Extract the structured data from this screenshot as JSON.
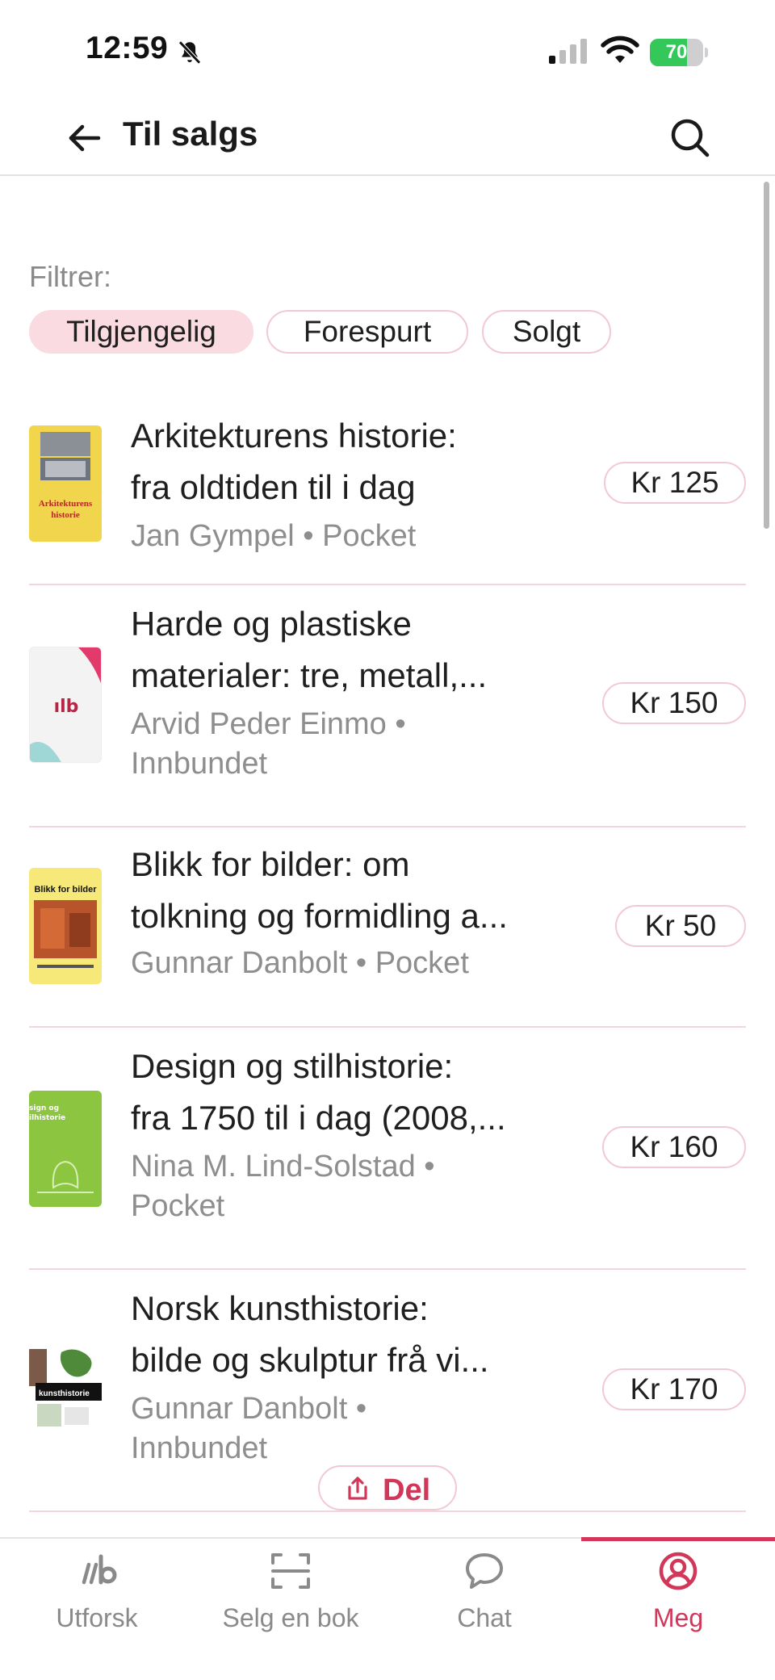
{
  "status_bar": {
    "time": "12:59",
    "battery_percent": 70,
    "battery_label": "70"
  },
  "header": {
    "title": "Til salgs",
    "back_icon": "arrow-left-icon",
    "search_icon": "search-icon"
  },
  "filters": {
    "label": "Filtrer:",
    "chips": [
      {
        "label": "Tilgjengelig",
        "active": true
      },
      {
        "label": "Forespurt",
        "active": false
      },
      {
        "label": "Solgt",
        "active": false
      }
    ]
  },
  "listings": [
    {
      "title_line1": "Arkitekturens historie:",
      "title_line2": "fra oldtiden til i dag",
      "meta_line1": "Jan Gympel • Pocket",
      "meta_line2": "",
      "price": "Kr 125",
      "cover_text": "Arkitekturens historie"
    },
    {
      "title_line1": "Harde og plastiske",
      "title_line2": "materialer: tre, metall,...",
      "meta_line1": "Arvid Peder Einmo •",
      "meta_line2": "Innbundet",
      "price": "Kr 150",
      "cover_text": "ılb"
    },
    {
      "title_line1": "Blikk for bilder: om",
      "title_line2": "tolkning og formidling a...",
      "meta_line1": "Gunnar Danbolt • Pocket",
      "meta_line2": "",
      "price": "Kr 50",
      "cover_text": "Blikk for bilder"
    },
    {
      "title_line1": "Design og stilhistorie:",
      "title_line2": "fra 1750 til i dag (2008,...",
      "meta_line1": "Nina M. Lind-Solstad •",
      "meta_line2": "Pocket",
      "price": "Kr 160",
      "cover_text": "sign og ilhistorie"
    },
    {
      "title_line1": "Norsk kunsthistorie:",
      "title_line2": "bilde og skulptur frå vi...",
      "meta_line1": "Gunnar Danbolt •",
      "meta_line2": "Innbundet",
      "price": "Kr 170",
      "cover_text": "kunsthistorie"
    }
  ],
  "share": {
    "label": "Del",
    "icon": "share-icon"
  },
  "bottom_nav": [
    {
      "label": "Utforsk",
      "icon": "lb-logo-icon",
      "active": false
    },
    {
      "label": "Selg en bok",
      "icon": "scan-icon",
      "active": false
    },
    {
      "label": "Chat",
      "icon": "chat-bubble-icon",
      "active": false
    },
    {
      "label": "Meg",
      "icon": "user-circle-icon",
      "active": true
    }
  ],
  "colors": {
    "accent": "#d2375a",
    "chip_active_bg": "#fadbe2",
    "chip_border": "#f2c9d3",
    "battery_green": "#34c759"
  }
}
